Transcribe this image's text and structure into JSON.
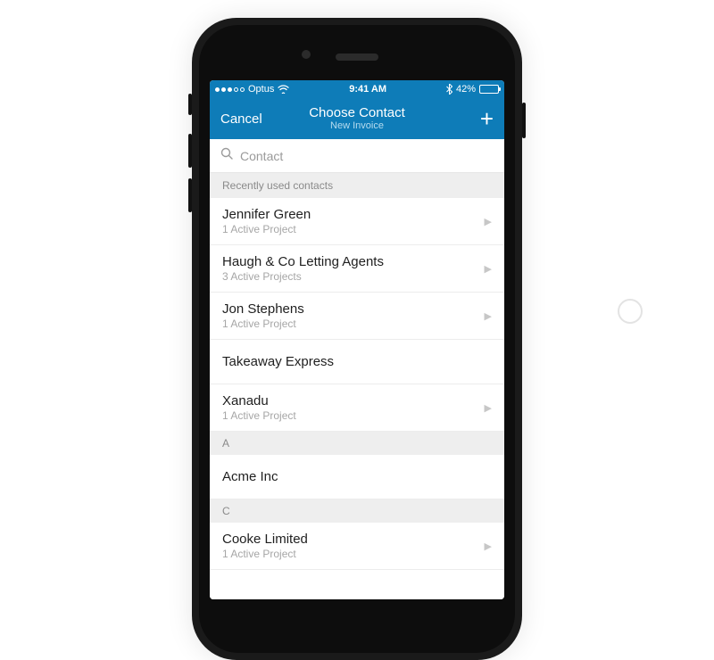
{
  "status": {
    "carrier": "Optus",
    "time": "9:41 AM",
    "battery_pct": "42%"
  },
  "nav": {
    "cancel": "Cancel",
    "title": "Choose Contact",
    "subtitle": "New Invoice"
  },
  "search": {
    "placeholder": "Contact"
  },
  "recent_header": "Recently used contacts",
  "recent": [
    {
      "name": "Jennifer Green",
      "sub": "1 Active Project",
      "chev": true
    },
    {
      "name": "Haugh & Co Letting Agents",
      "sub": "3 Active Projects",
      "chev": true
    },
    {
      "name": "Jon Stephens",
      "sub": "1 Active Project",
      "chev": true
    },
    {
      "name": "Takeaway Express",
      "sub": "",
      "chev": false
    },
    {
      "name": "Xanadu",
      "sub": "1 Active Project",
      "chev": true
    }
  ],
  "sections": [
    {
      "letter": "A",
      "rows": [
        {
          "name": "Acme Inc",
          "sub": "",
          "chev": false
        }
      ]
    },
    {
      "letter": "C",
      "rows": [
        {
          "name": "Cooke Limited",
          "sub": "1 Active Project",
          "chev": true
        }
      ]
    }
  ]
}
